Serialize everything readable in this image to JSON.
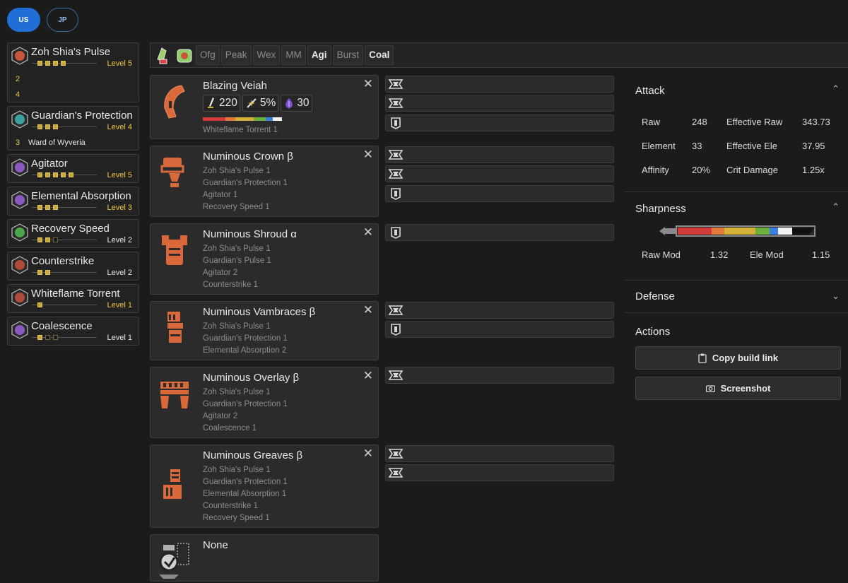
{
  "region": {
    "us": "US",
    "jp": "JP"
  },
  "skills": [
    {
      "name": "Zoh Shia's Pulse",
      "pips_on": 4,
      "pips_total": 4,
      "level": "Level 5",
      "gold": true,
      "icon": "zoh-shia-skill-icon",
      "set_bonuses": [
        {
          "num": "2",
          "name": ""
        },
        {
          "num": "4",
          "name": ""
        }
      ]
    },
    {
      "name": "Guardian's Protection",
      "pips_on": 3,
      "pips_total": 3,
      "level": "Level 4",
      "gold": true,
      "icon": "guardian-skill-icon",
      "set_bonuses": [
        {
          "num": "3",
          "name": "Ward of Wyveria"
        }
      ]
    },
    {
      "name": "Agitator",
      "pips_on": 5,
      "pips_total": 5,
      "level": "Level 5",
      "gold": true,
      "icon": "agitator-skill-icon"
    },
    {
      "name": "Elemental Absorption",
      "pips_on": 3,
      "pips_total": 3,
      "level": "Level 3",
      "gold": true,
      "icon": "elemental-absorption-skill-icon"
    },
    {
      "name": "Recovery Speed",
      "pips_on": 2,
      "pips_total": 3,
      "level": "Level 2",
      "gold": false,
      "icon": "recovery-speed-skill-icon"
    },
    {
      "name": "Counterstrike",
      "pips_on": 2,
      "pips_total": 2,
      "level": "Level 2",
      "gold": false,
      "icon": "counterstrike-skill-icon"
    },
    {
      "name": "Whiteflame Torrent",
      "pips_on": 1,
      "pips_total": 1,
      "level": "Level 1",
      "gold": true,
      "icon": "whiteflame-skill-icon"
    },
    {
      "name": "Coalescence",
      "pips_on": 1,
      "pips_total": 3,
      "level": "Level 1",
      "gold": false,
      "icon": "coalescence-skill-icon"
    }
  ],
  "filters": {
    "icons": [
      "bowgun-filter-icon",
      "charm-filter-icon"
    ],
    "chips": [
      {
        "label": "Ofg",
        "active": false
      },
      {
        "label": "Peak",
        "active": false
      },
      {
        "label": "Wex",
        "active": false
      },
      {
        "label": "MM",
        "active": false
      },
      {
        "label": "Agi",
        "active": true
      },
      {
        "label": "Burst",
        "active": false
      },
      {
        "label": "Coal",
        "active": true
      }
    ]
  },
  "weapon": {
    "name": "Blazing Veiah",
    "attack": "220",
    "affinity": "5%",
    "element": "30",
    "skill": "Whiteflame Torrent 1",
    "close": "✕"
  },
  "armor": [
    {
      "name": "Numinous Crown β",
      "skills": [
        "Zoh Shia's Pulse 1",
        "Guardian's Protection 1",
        "Agitator 1",
        "Recovery Speed 1"
      ]
    },
    {
      "name": "Numinous Shroud α",
      "skills": [
        "Zoh Shia's Pulse 1",
        "Guardian's Pulse 1",
        "Agitator 2",
        "Counterstrike 1"
      ]
    },
    {
      "name": "Numinous Vambraces β",
      "skills": [
        "Zoh Shia's Pulse 1",
        "Guardian's Protection 1",
        "Elemental Absorption 2"
      ]
    },
    {
      "name": "Numinous Overlay β",
      "skills": [
        "Zoh Shia's Pulse 1",
        "Guardian's Protection 1",
        "Agitator 2",
        "Coalescence 1"
      ]
    },
    {
      "name": "Numinous Greaves β",
      "skills": [
        "Zoh Shia's Pulse 1",
        "Guardian's Protection 1",
        "Elemental Absorption 1",
        "Counterstrike 1",
        "Recovery Speed 1"
      ]
    }
  ],
  "charm": {
    "name": "None"
  },
  "attack": {
    "title": "Attack",
    "raw_label": "Raw",
    "raw": "248",
    "eff_raw_label": "Effective Raw",
    "eff_raw": "343.73",
    "element_label": "Element",
    "element": "33",
    "eff_ele_label": "Effective Ele",
    "eff_ele": "37.95",
    "affinity_label": "Affinity",
    "affinity": "20%",
    "crit_label": "Crit Damage",
    "crit": "1.25x"
  },
  "sharpness": {
    "title": "Sharpness",
    "raw_mod_label": "Raw Mod",
    "raw_mod": "1.32",
    "ele_mod_label": "Ele Mod",
    "ele_mod": "1.15"
  },
  "defense": {
    "title": "Defense"
  },
  "actions": {
    "title": "Actions",
    "copy_link": "Copy build link",
    "screenshot": "Screenshot"
  },
  "colors": {
    "accent": "#1f6fd6",
    "gold": "#f0c43c",
    "armor_orange": "#d9683a",
    "panel": "#2b2b2b"
  }
}
